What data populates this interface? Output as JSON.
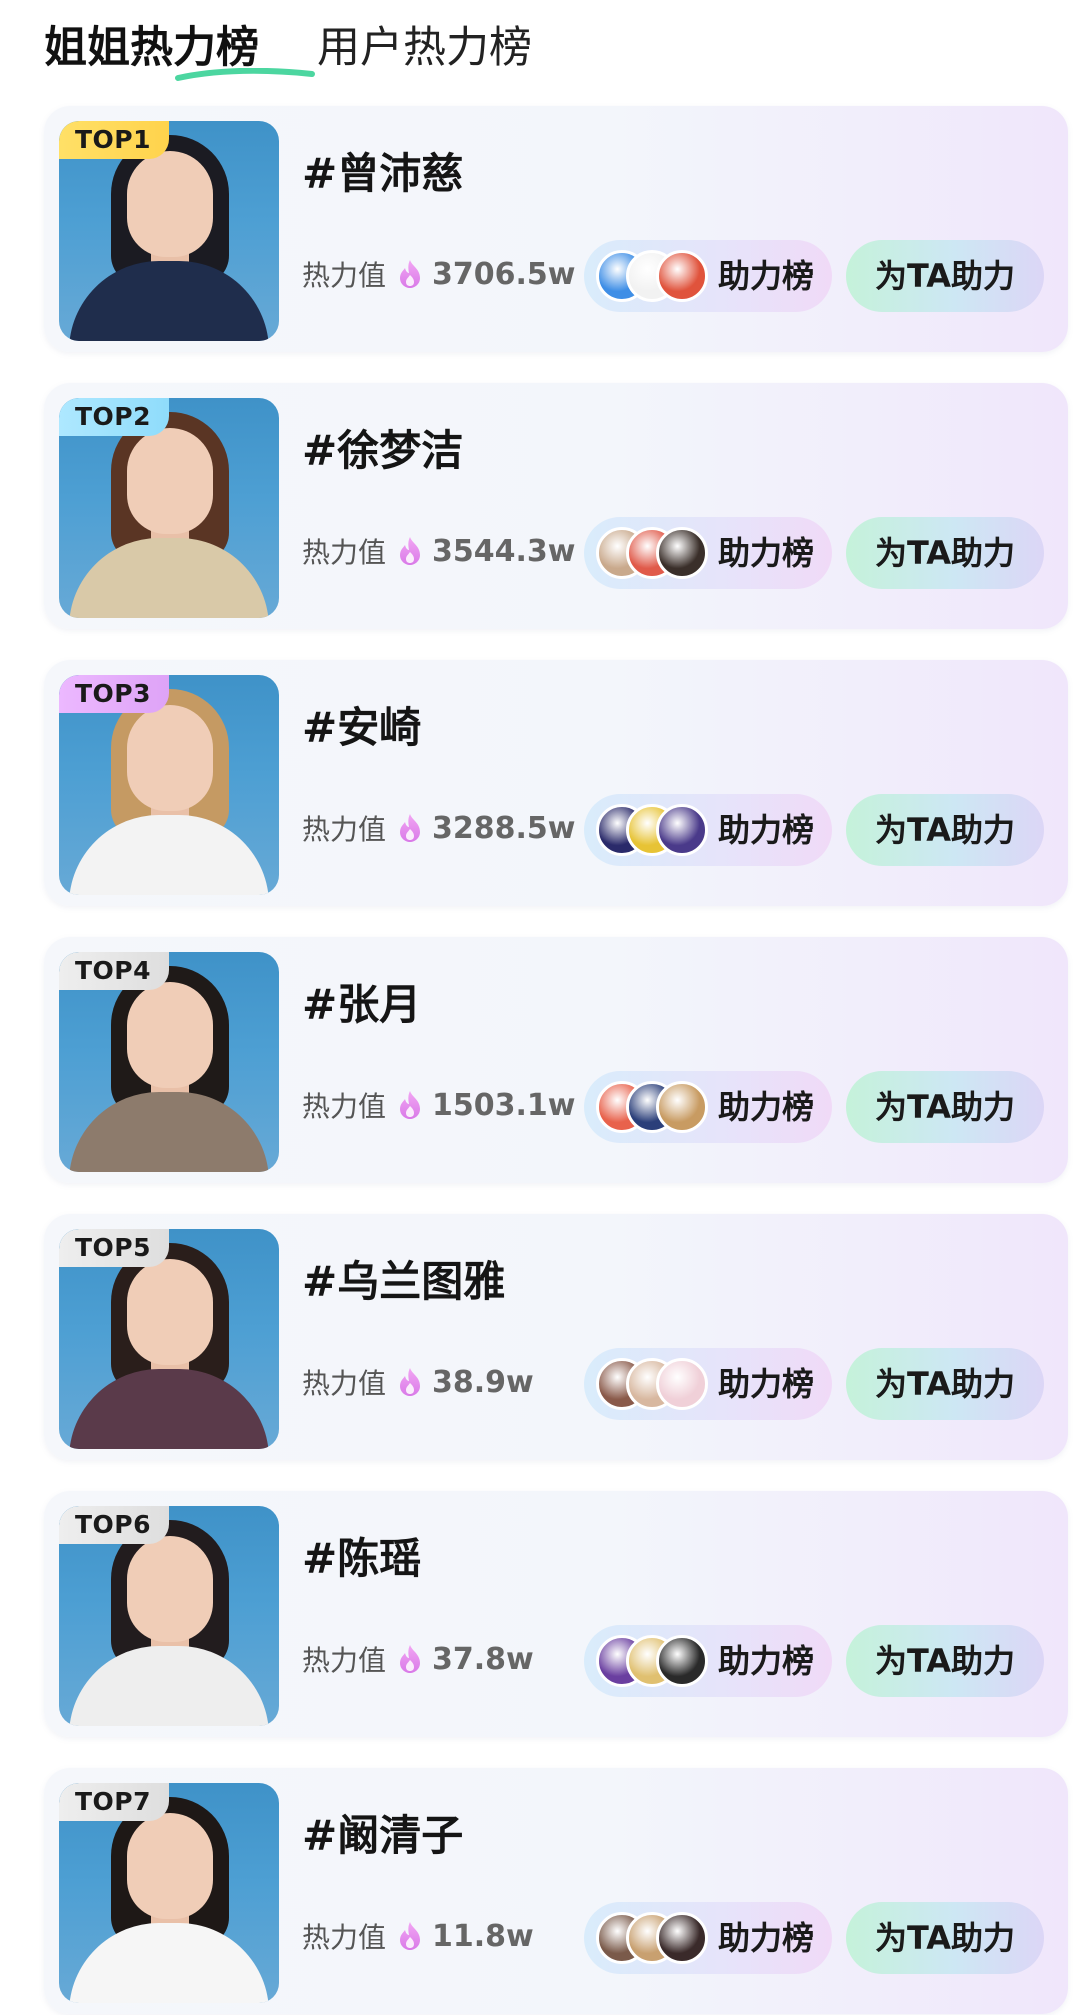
{
  "tabs": [
    {
      "label": "姐姐热力榜",
      "active": true
    },
    {
      "label": "用户热力榜",
      "active": false
    }
  ],
  "heat_label": "热力值",
  "rank_button_label": "助力榜",
  "help_button_label": "为TA助力",
  "colors": {
    "tab_underline": "#4cd6a0",
    "top1_badge": "#ffd34c",
    "top2_badge": "#8fdcfb",
    "top3_badge": "#dea3f7",
    "other_badge": "#dedede",
    "flame": "#e58ef0"
  },
  "items": [
    {
      "rank": "TOP1",
      "name": "#曾沛慈",
      "heat": "3706.5w",
      "hair": "#1b1b22",
      "outfit": "#1f2d4c",
      "avatars": [
        "#3e8ee6",
        "#f2f2f2",
        "#e0533c"
      ]
    },
    {
      "rank": "TOP2",
      "name": "#徐梦洁",
      "heat": "3544.3w",
      "hair": "#5a3524",
      "outfit": "#d9c9a8",
      "avatars": [
        "#c9a98c",
        "#e05a4a",
        "#3a2f2a"
      ]
    },
    {
      "rank": "TOP3",
      "name": "#安崎",
      "heat": "3288.5w",
      "hair": "#c59a63",
      "outfit": "#f3f3f3",
      "avatars": [
        "#2a2a6a",
        "#e7c335",
        "#4a3a8a"
      ]
    },
    {
      "rank": "TOP4",
      "name": "#张月",
      "heat": "1503.1w",
      "hair": "#1f1a18",
      "outfit": "#8d7b6c",
      "avatars": [
        "#e8624c",
        "#2b3f7a",
        "#c89b62"
      ]
    },
    {
      "rank": "TOP5",
      "name": "#乌兰图雅",
      "heat": "38.9w",
      "hair": "#2a1e1b",
      "outfit": "#5a3a4a",
      "avatars": [
        "#8a5a4a",
        "#d8b8a0",
        "#f0d0d8"
      ]
    },
    {
      "rank": "TOP6",
      "name": "#陈瑶",
      "heat": "37.8w",
      "hair": "#221c1e",
      "outfit": "#eeeeee",
      "avatars": [
        "#6a3fa0",
        "#e0c070",
        "#2a2a2a"
      ]
    },
    {
      "rank": "TOP7",
      "name": "#阚清子",
      "heat": "11.8w",
      "hair": "#1e1816",
      "outfit": "#f6f6f6",
      "avatars": [
        "#7a5a4a",
        "#c8a070",
        "#3a2a2a"
      ]
    }
  ]
}
